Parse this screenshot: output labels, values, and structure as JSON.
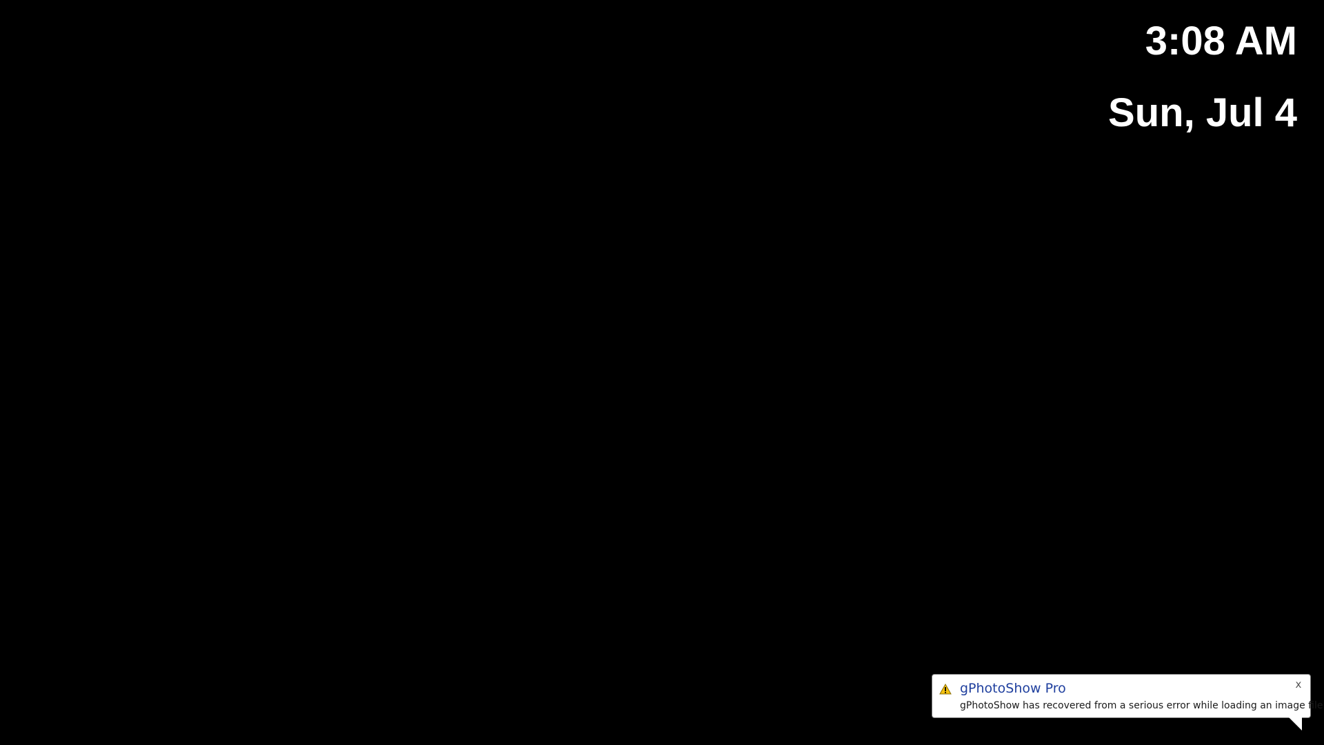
{
  "clock": {
    "time": "3:08 AM",
    "date": "Sun, Jul 4"
  },
  "notification": {
    "title": "gPhotoShow Pro",
    "message": "gPhotoShow has recovered from a serious error while loading an image file",
    "icon": "warning-icon",
    "close_label": "x"
  },
  "colors": {
    "background": "#000000",
    "clock_text": "#ffffff",
    "title_text": "#1f3f9e",
    "warning_fill": "#f5c211"
  }
}
